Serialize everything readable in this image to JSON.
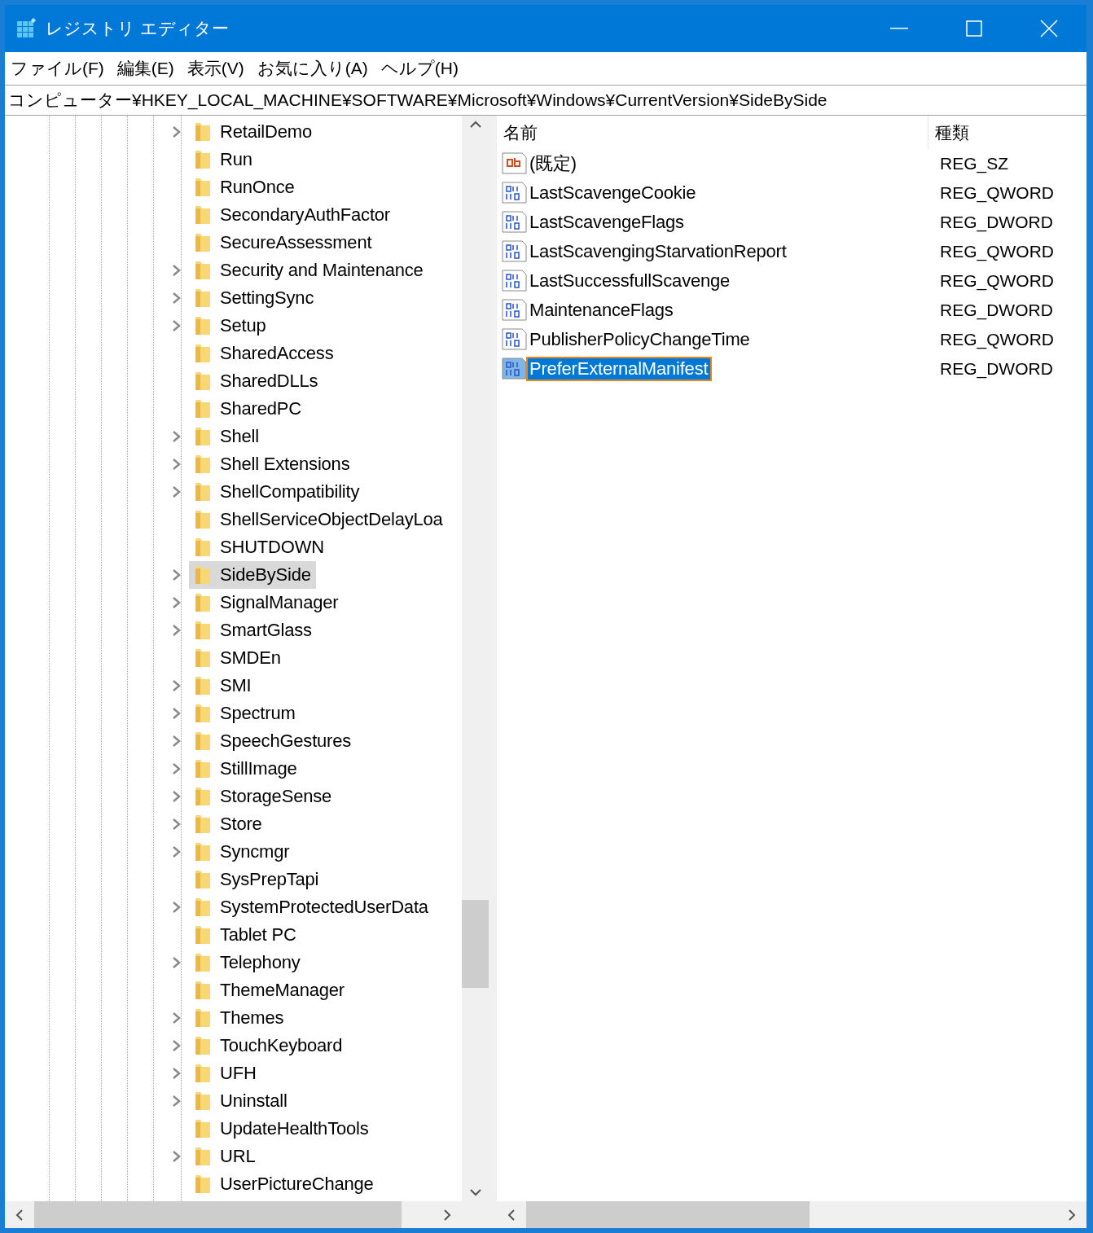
{
  "window": {
    "title": "レジストリ エディター"
  },
  "menu": [
    "ファイル(F)",
    "編集(E)",
    "表示(V)",
    "お気に入り(A)",
    "ヘルプ(H)"
  ],
  "address": "コンピューター¥HKEY_LOCAL_MACHINE¥SOFTWARE¥Microsoft¥Windows¥CurrentVersion¥SideBySide",
  "tree": [
    {
      "label": "RetailDemo",
      "expandable": true,
      "selected": false
    },
    {
      "label": "Run",
      "expandable": false,
      "selected": false
    },
    {
      "label": "RunOnce",
      "expandable": false,
      "selected": false
    },
    {
      "label": "SecondaryAuthFactor",
      "expandable": false,
      "selected": false
    },
    {
      "label": "SecureAssessment",
      "expandable": false,
      "selected": false
    },
    {
      "label": "Security and Maintenance",
      "expandable": true,
      "selected": false
    },
    {
      "label": "SettingSync",
      "expandable": true,
      "selected": false
    },
    {
      "label": "Setup",
      "expandable": true,
      "selected": false
    },
    {
      "label": "SharedAccess",
      "expandable": false,
      "selected": false
    },
    {
      "label": "SharedDLLs",
      "expandable": false,
      "selected": false
    },
    {
      "label": "SharedPC",
      "expandable": false,
      "selected": false
    },
    {
      "label": "Shell",
      "expandable": true,
      "selected": false
    },
    {
      "label": "Shell Extensions",
      "expandable": true,
      "selected": false
    },
    {
      "label": "ShellCompatibility",
      "expandable": true,
      "selected": false
    },
    {
      "label": "ShellServiceObjectDelayLoa",
      "expandable": false,
      "selected": false
    },
    {
      "label": "SHUTDOWN",
      "expandable": false,
      "selected": false
    },
    {
      "label": "SideBySide",
      "expandable": true,
      "selected": true
    },
    {
      "label": "SignalManager",
      "expandable": true,
      "selected": false
    },
    {
      "label": "SmartGlass",
      "expandable": true,
      "selected": false
    },
    {
      "label": "SMDEn",
      "expandable": false,
      "selected": false
    },
    {
      "label": "SMI",
      "expandable": true,
      "selected": false
    },
    {
      "label": "Spectrum",
      "expandable": true,
      "selected": false
    },
    {
      "label": "SpeechGestures",
      "expandable": true,
      "selected": false
    },
    {
      "label": "StillImage",
      "expandable": true,
      "selected": false
    },
    {
      "label": "StorageSense",
      "expandable": true,
      "selected": false
    },
    {
      "label": "Store",
      "expandable": true,
      "selected": false
    },
    {
      "label": "Syncmgr",
      "expandable": true,
      "selected": false
    },
    {
      "label": "SysPrepTapi",
      "expandable": false,
      "selected": false
    },
    {
      "label": "SystemProtectedUserData",
      "expandable": true,
      "selected": false
    },
    {
      "label": "Tablet PC",
      "expandable": false,
      "selected": false
    },
    {
      "label": "Telephony",
      "expandable": true,
      "selected": false
    },
    {
      "label": "ThemeManager",
      "expandable": false,
      "selected": false
    },
    {
      "label": "Themes",
      "expandable": true,
      "selected": false
    },
    {
      "label": "TouchKeyboard",
      "expandable": true,
      "selected": false
    },
    {
      "label": "UFH",
      "expandable": true,
      "selected": false
    },
    {
      "label": "Uninstall",
      "expandable": true,
      "selected": false
    },
    {
      "label": "UpdateHealthTools",
      "expandable": false,
      "selected": false
    },
    {
      "label": "URL",
      "expandable": true,
      "selected": false
    },
    {
      "label": "UserPictureChange",
      "expandable": false,
      "selected": false
    }
  ],
  "values": {
    "columns": [
      "名前",
      "種類"
    ],
    "rows": [
      {
        "kind": "string",
        "name": "(既定)",
        "type": "REG_SZ",
        "selected": false
      },
      {
        "kind": "binary",
        "name": "LastScavengeCookie",
        "type": "REG_QWORD",
        "selected": false
      },
      {
        "kind": "binary",
        "name": "LastScavengeFlags",
        "type": "REG_DWORD",
        "selected": false
      },
      {
        "kind": "binary",
        "name": "LastScavengingStarvationReport",
        "type": "REG_QWORD",
        "selected": false
      },
      {
        "kind": "binary",
        "name": "LastSuccessfullScavenge",
        "type": "REG_QWORD",
        "selected": false
      },
      {
        "kind": "binary",
        "name": "MaintenanceFlags",
        "type": "REG_DWORD",
        "selected": false
      },
      {
        "kind": "binary",
        "name": "PublisherPolicyChangeTime",
        "type": "REG_QWORD",
        "selected": false
      },
      {
        "kind": "binary",
        "name": "PreferExternalManifest",
        "type": "REG_DWORD",
        "selected": true
      }
    ]
  }
}
